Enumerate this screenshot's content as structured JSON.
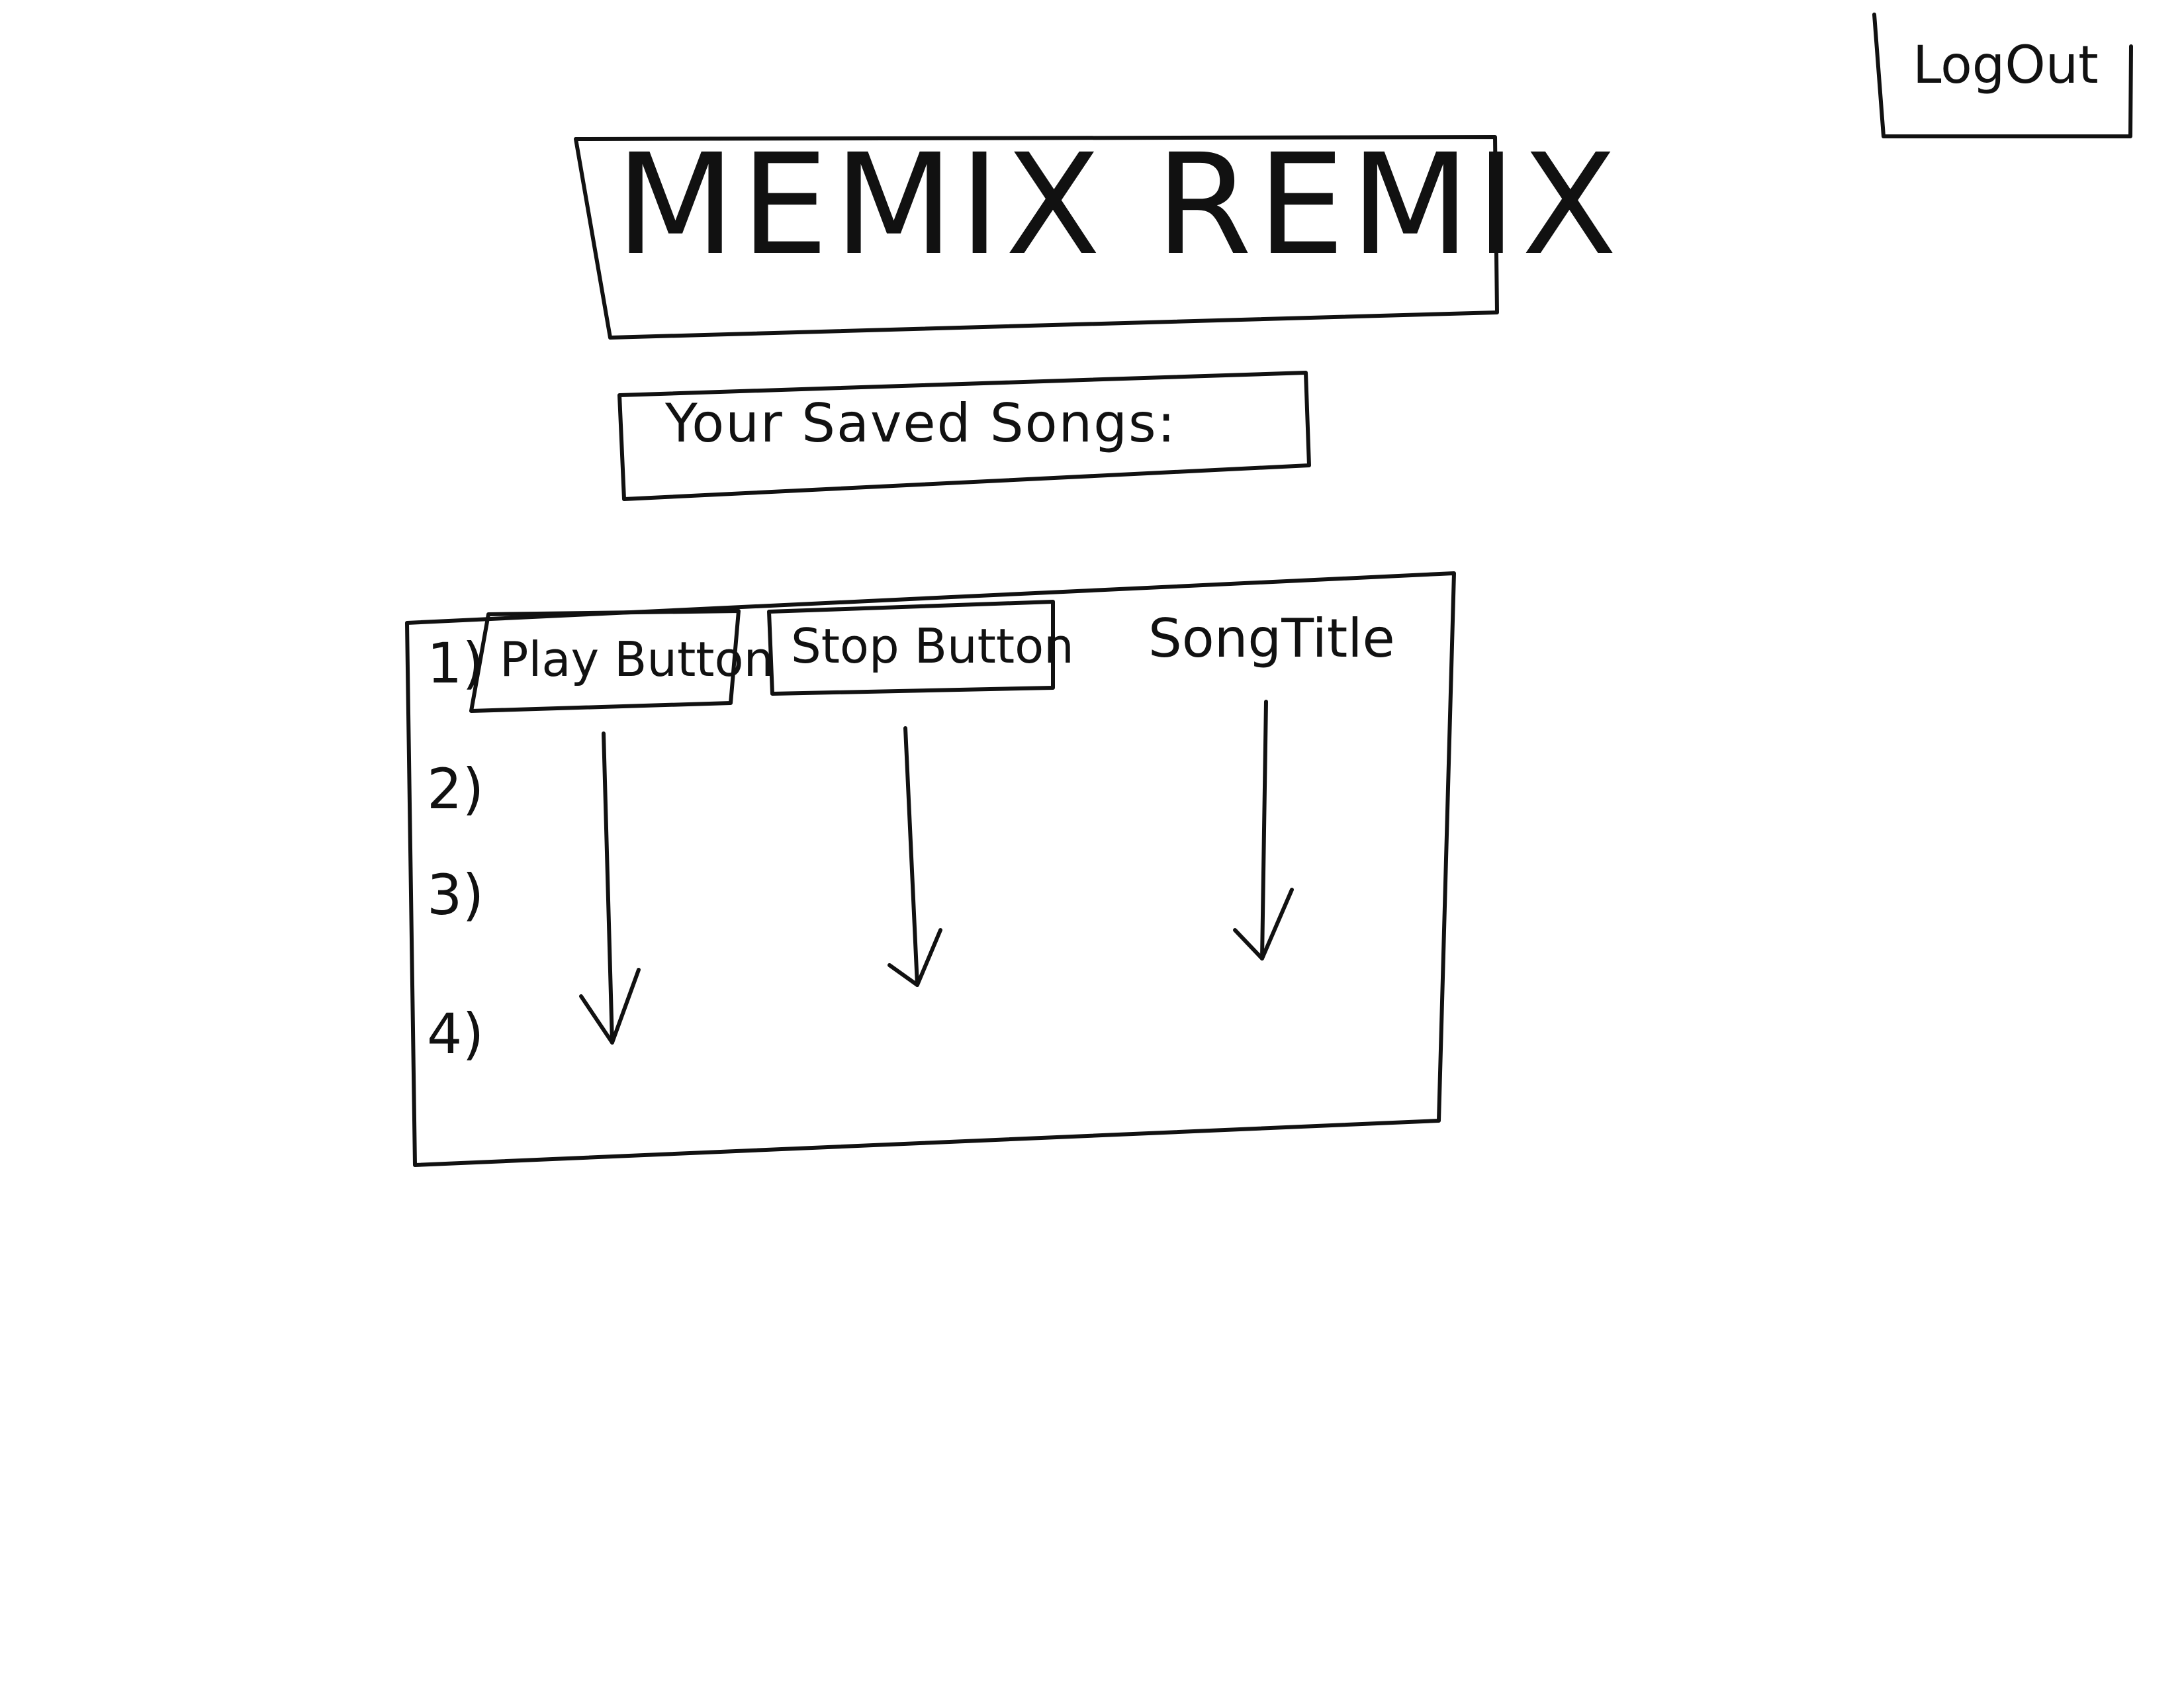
{
  "header": {
    "logout_label": "LogOut",
    "app_title": "MEMIX REMIX",
    "saved_songs_heading": "Your Saved Songs:"
  },
  "songs_table": {
    "row_numbers": [
      "1)",
      "2)",
      "3)",
      "4)"
    ],
    "play_button_label": "Play Button",
    "stop_button_label": "Stop Button",
    "song_title_label": "SongTitle"
  }
}
